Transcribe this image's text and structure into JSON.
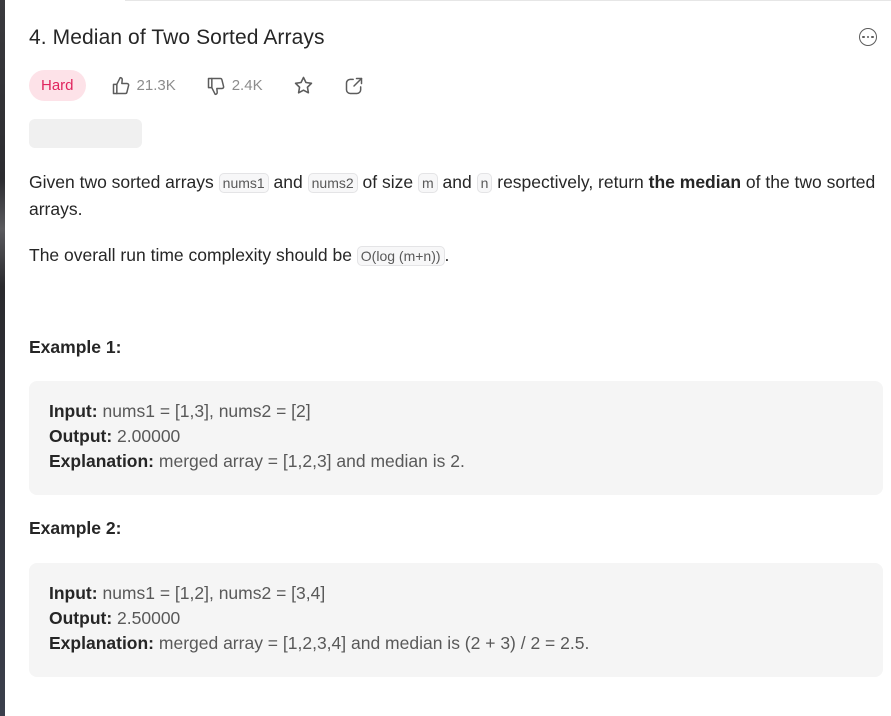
{
  "problem": {
    "title": "4. Median of Two Sorted Arrays",
    "difficulty": "Hard",
    "likes": "21.3K",
    "dislikes": "2.4K"
  },
  "description": {
    "p1_a": "Given two sorted arrays ",
    "code_nums1": "nums1",
    "p1_b": " and ",
    "code_nums2": "nums2",
    "p1_c": " of size ",
    "code_m": "m",
    "p1_d": " and ",
    "code_n": "n",
    "p1_e": " respectively, return ",
    "p1_bold": "the median",
    "p1_f": " of the two sorted arrays.",
    "p2_a": "The overall run time complexity should be ",
    "code_complexity": "O(log (m+n))",
    "p2_b": "."
  },
  "examples": [
    {
      "title": "Example 1:",
      "input_label": "Input:",
      "input": " nums1 = [1,3], nums2 = [2]",
      "output_label": "Output:",
      "output": " 2.00000",
      "explanation_label": "Explanation:",
      "explanation": " merged array = [1,2,3] and median is 2."
    },
    {
      "title": "Example 2:",
      "input_label": "Input:",
      "input": " nums1 = [1,2], nums2 = [3,4]",
      "output_label": "Output:",
      "output": " 2.50000",
      "explanation_label": "Explanation:",
      "explanation": " merged array = [1,2,3,4] and median is (2 + 3) / 2 = 2.5."
    }
  ],
  "icons": {
    "more": "more-options-icon",
    "like": "thumbs-up-icon",
    "dislike": "thumbs-down-icon",
    "star": "star-icon",
    "share": "share-icon"
  },
  "colors": {
    "hard_badge_bg": "#fde2e8",
    "hard_badge_text": "#e0245e",
    "example_bg": "#f5f5f5"
  }
}
